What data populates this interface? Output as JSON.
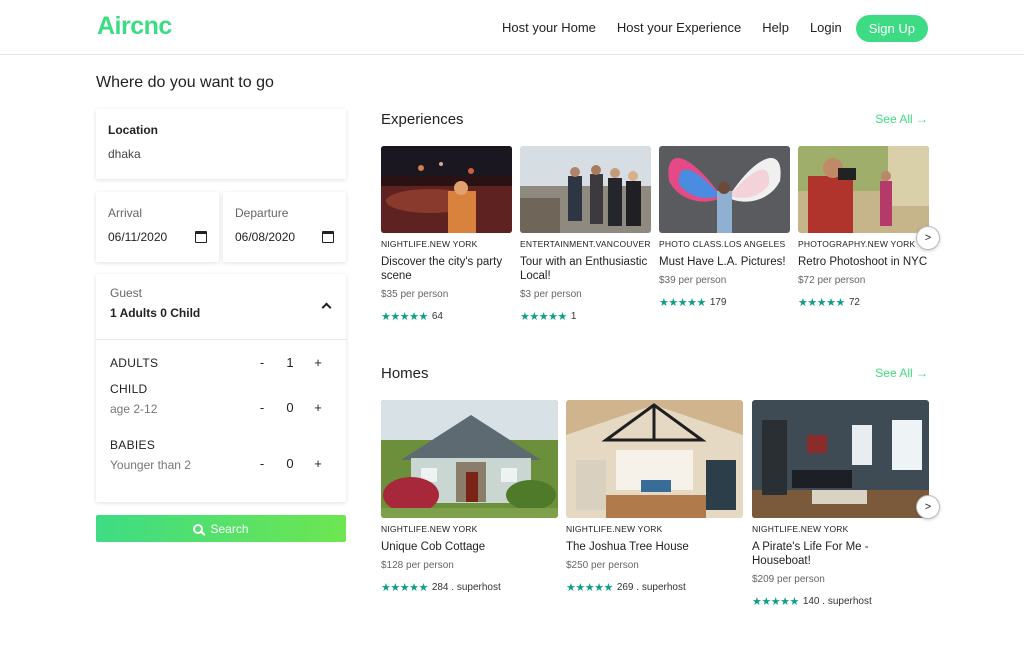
{
  "brand": {
    "name": "Aircnc"
  },
  "nav": {
    "host_home": "Host your Home",
    "host_experience": "Host your Experience",
    "help": "Help",
    "login": "Login",
    "signup": "Sign Up"
  },
  "search_panel": {
    "title": "Where do you want to go",
    "location": {
      "label": "Location",
      "value": "dhaka"
    },
    "arrival": {
      "label": "Arrival",
      "value": "06/11/2020"
    },
    "departure": {
      "label": "Departure",
      "value": "06/08/2020"
    },
    "guest": {
      "label": "Guest",
      "summary": "1 Adults 0 Child",
      "adults": {
        "label": "ADULTS",
        "count": "1"
      },
      "child": {
        "label": "CHILD",
        "sub": "age 2-12",
        "count": "0"
      },
      "babies": {
        "label": "BABIES",
        "sub": "Younger than 2",
        "count": "0"
      },
      "minus": "-",
      "plus": "+"
    },
    "search_button": "Search"
  },
  "experiences": {
    "title": "Experiences",
    "see_all": "See All →",
    "items": [
      {
        "category": "NIGHTLIFE.NEW YORK",
        "title": "Discover the city's party scene",
        "price": "$35 per person",
        "stars": "★★★★★",
        "reviews": "64"
      },
      {
        "category": "ENTERTAINMENT.VANCOUVER",
        "title": "Tour with an Enthusiastic Local!",
        "price": "$3 per person",
        "stars": "★★★★★",
        "reviews": "1"
      },
      {
        "category": "PHOTO CLASS.LOS ANGELES",
        "title": "Must Have L.A. Pictures!",
        "price": "$39 per person",
        "stars": "★★★★★",
        "reviews": "179"
      },
      {
        "category": "PHOTOGRAPHY.NEW YORK",
        "title": "Retro Photoshoot in NYC",
        "price": "$72 per person",
        "stars": "★★★★★",
        "reviews": "72"
      }
    ]
  },
  "homes": {
    "title": "Homes",
    "see_all": "See All →",
    "items": [
      {
        "category": "NIGHTLIFE.NEW YORK",
        "title": "Unique Cob Cottage",
        "price": "$128 per person",
        "stars": "★★★★★",
        "reviews": "284 . superhost"
      },
      {
        "category": "NIGHTLIFE.NEW YORK",
        "title": "The Joshua Tree House",
        "price": "$250 per person",
        "stars": "★★★★★",
        "reviews": "269 . superhost"
      },
      {
        "category": "NIGHTLIFE.NEW YORK",
        "title": "A Pirate's Life For Me - Houseboat!",
        "price": "$209 per person",
        "stars": "★★★★★",
        "reviews": "140 . superhost"
      }
    ]
  },
  "icons": {
    "next": "›",
    "arrow_glyph": ">"
  },
  "colors": {
    "accent": "#3ddc84",
    "stars": "#0f9d8a"
  }
}
